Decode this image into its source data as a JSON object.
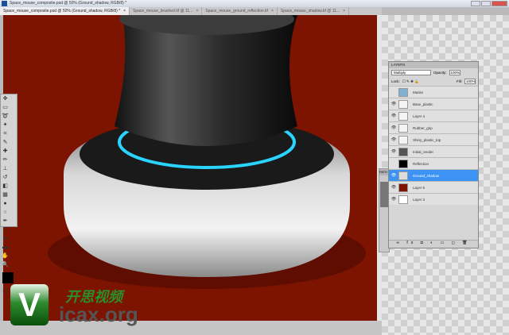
{
  "window": {
    "title": "Space_mouse_composite.psd @ 50% (Ground_shadow, RGB/8) *"
  },
  "tabs": [
    {
      "label": "Space_mouse_composite.psd @ 50% (Ground_shadow, RGB/8) *",
      "active": true
    },
    {
      "label": "Space_mouse_brushed.tif @ 11...",
      "active": false
    },
    {
      "label": "Space_mouse_ground_reflection.tif",
      "active": false
    },
    {
      "label": "Space_mouse_shadow.tif @ 11...",
      "active": false
    }
  ],
  "layers_panel": {
    "title": "LAYERS",
    "blend_mode": "Multiply",
    "opacity_label": "Opacity:",
    "opacity": "100%",
    "lock_label": "Lock:",
    "fill_label": "Fill:",
    "fill": "100%",
    "layers": [
      {
        "name": "Masks",
        "visible": false,
        "thumb": "#7fb0d0"
      },
      {
        "name": "Base_plastic",
        "visible": true,
        "thumb": "#f4f4f4"
      },
      {
        "name": "Layer 4",
        "visible": true,
        "thumb": "#f4f4f4"
      },
      {
        "name": "Rubber_grip",
        "visible": true,
        "thumb": "#f4f4f4"
      },
      {
        "name": "Shiny_plastic_top",
        "visible": true,
        "thumb": "#f4f4f4"
      },
      {
        "name": "Initial_render",
        "visible": true,
        "thumb": "#555555"
      },
      {
        "name": "Reflection",
        "visible": false,
        "thumb": "#000000"
      },
      {
        "name": "Ground_shadow",
        "visible": true,
        "thumb": "#dddddd",
        "selected": true
      },
      {
        "name": "Layer 5",
        "visible": true,
        "thumb": "#7d1301"
      },
      {
        "name": "Layer 3",
        "visible": true,
        "thumb": "#ffffff"
      }
    ]
  },
  "paths_panel": {
    "title": "PATH"
  },
  "watermark": {
    "letter": "V",
    "chinese": "开思视频",
    "site": "icax.org"
  },
  "colors": {
    "canvas": "#7d1301",
    "selection": "#3d93f3",
    "glow": "#29d4ff"
  }
}
